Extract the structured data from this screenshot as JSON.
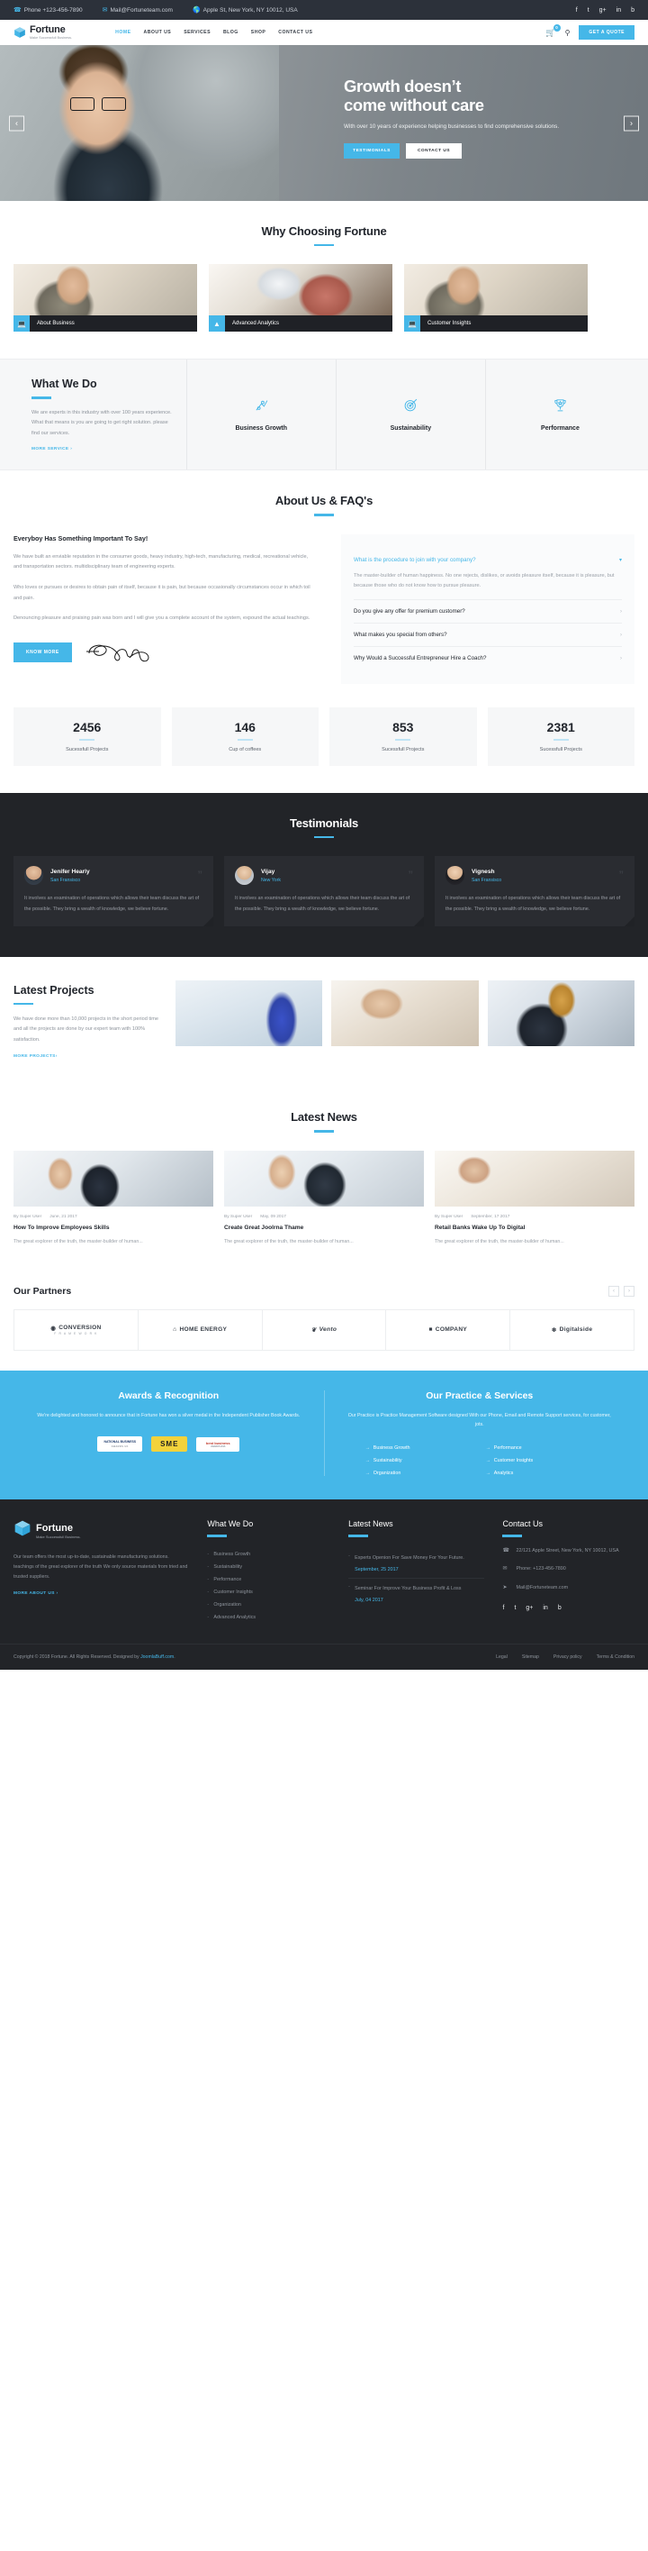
{
  "topbar": {
    "phone": "Phone +123-456-7890",
    "mail": "Mail@Fortuneteam.com",
    "address": "Apple St, New York, NY 10012, USA",
    "social": [
      "f",
      "t",
      "g+",
      "in",
      "b"
    ]
  },
  "brand": {
    "name": "Fortune",
    "tagline": "Make Successfull Business."
  },
  "nav": {
    "items": [
      "HOME",
      "ABOUT US",
      "SERVICES",
      "BLOG",
      "SHOP",
      "CONTACT US"
    ],
    "active": "HOME",
    "cart_count": "0",
    "quote_label": "GET A QUOTE"
  },
  "hero": {
    "title_line1": "Growth doesn’t",
    "title_line2": "come without care",
    "subtitle": "With over 10 years of experience helping businesses to find comprehensive solutions.",
    "btn_primary": "TESTIMONIALS",
    "btn_secondary": "CONTACT US",
    "arrow_left": "‹",
    "arrow_right": "›"
  },
  "why": {
    "title": "Why Choosing Fortune",
    "cards": [
      {
        "label": "About Business",
        "icon": "monitor-icon"
      },
      {
        "label": "Advanced Analytics",
        "icon": "chart-icon"
      },
      {
        "label": "Customer Insights",
        "icon": "monitor-icon"
      }
    ]
  },
  "what_we_do": {
    "title": "What We Do",
    "text": "We are experts in this industry with over 100 years experience. What that means is you are going to get right solution. please find our services.",
    "more": "MORE SERVICE ›",
    "services": [
      {
        "name": "Business Growth",
        "icon": "growth-icon"
      },
      {
        "name": "Sustainability",
        "icon": "target-icon"
      },
      {
        "name": "Performance",
        "icon": "trophy-icon"
      }
    ]
  },
  "about": {
    "title": "About Us & FAQ's",
    "heading": "Everyboy Has Something Important To Say!",
    "para1": "We have built an enviable reputation in the consumer goods, heavy industry, high-tech, manufacturing, medical, recreational vehicle, and transportation sectors. multidisciplinary team of engineering experts.",
    "para2": "Who loves or pursues or desires to obtain pain of itself, because it is pain, but because occasionally circumstances occur in which toil and pain.",
    "para3": "Denouncing pleasure and praising pain was born and I will give you a complete account of the system, expound the actual teachings.",
    "know_more": "KNOW MORE",
    "faqs": [
      {
        "q": "What is the procedure to join with your company?",
        "a": "The master-builder of human happiness. No one rejects, dislikes, or avoids pleasure itself, because it is pleasure, but because those who do not know how to pursue pleasure.",
        "open": true
      },
      {
        "q": "Do you give any offer for premium customer?",
        "a": "",
        "open": false
      },
      {
        "q": "What makes you special from others?",
        "a": "",
        "open": false
      },
      {
        "q": "Why Would a Successful Entrepreneur Hire a Coach?",
        "a": "",
        "open": false
      }
    ]
  },
  "counters": [
    {
      "num": "2456",
      "label": "Sucessfull Projects"
    },
    {
      "num": "146",
      "label": "Cup of coffees"
    },
    {
      "num": "853",
      "label": "Sucessfull Projects"
    },
    {
      "num": "2381",
      "label": "Sucessfull Projects"
    }
  ],
  "testimonials": {
    "title": "Testimonials",
    "items": [
      {
        "name": "Jenifer Hearly",
        "location": "San Fransisco",
        "text": "It involves an examination of operations which allows their team discuss the art of the possible. They bring a wealth of knowledge, we believe fortune."
      },
      {
        "name": "Vijay",
        "location": "New York",
        "text": "It involves an examination of operations which allows their team discuss the art of the possible. They bring a wealth of knowledge, we believe fortune."
      },
      {
        "name": "Vignesh",
        "location": "San Fransisco",
        "text": "It involves an examination of operations which allows their team discuss the art of the possible. They bring a wealth of knowledge, we believe fortune."
      }
    ]
  },
  "projects": {
    "title": "Latest Projects",
    "text": "We have done more than 10,000 projects in the short period time and all the projects are done by our expert team with 100% satisfaction.",
    "more": "MORE PROJECTS›"
  },
  "news": {
    "title": "Latest News",
    "items": [
      {
        "author": "By Super User",
        "date": "June, 21 2017",
        "title": "How To Improve Employees Skills",
        "excerpt": "The great explorer of the truth, the master-builder of human..."
      },
      {
        "author": "By Super User",
        "date": "May, 09 2017",
        "title": "Create Great Joolrna Thame",
        "excerpt": "The great explorer of the truth, the master-builder of human..."
      },
      {
        "author": "By Super User",
        "date": "September, 17 2017",
        "title": "Retail Banks Wake Up To Digital",
        "excerpt": "The great explorer of the truth, the master-builder of human..."
      }
    ]
  },
  "partners": {
    "title": "Our Partners",
    "prev": "‹",
    "next": "›",
    "items": [
      {
        "name": "CONVERSION",
        "sub": "F R A M E W O R K"
      },
      {
        "name": "HOME ENERGY",
        "sub": ""
      },
      {
        "name": "Vento",
        "sub": ""
      },
      {
        "name": "COMPANY",
        "sub": ""
      },
      {
        "name": "Digitalside",
        "sub": ""
      }
    ]
  },
  "awards": {
    "title": "Awards & Recognition",
    "text": "We're delighted and honored to announce that in Fortune has won a silver medal in the Independent Publisher Book Awards.",
    "badges": [
      {
        "title": "NATIONAL BUSINESS",
        "sub": "AWARDS UK"
      },
      {
        "title": "SME",
        "sub": ""
      },
      {
        "title": "best business",
        "sub": "AWARDS 2016"
      }
    ]
  },
  "practice": {
    "title": "Our Practice & Services",
    "text": "Our Practice is Practice Management Software designed With our Phone, Email and Remote Support services, for customer, jots.",
    "items": [
      "Business Growth",
      "Performance",
      "Sustainability",
      "Customer Insights",
      "Organization",
      "Analytics"
    ]
  },
  "footer": {
    "about_text": "Our team offers the most up-to-date, sustainable manufacturing solutions. teachings of the great explorer of the truth We only source materials from tried and trusted suppliers.",
    "more_about": "MORE ABOUT US ›",
    "wwd_title": "What We Do",
    "wwd_items": [
      "Business Growth",
      "Sustainability",
      "Performance",
      "Customer Insights",
      "Organization",
      "Advanced Analytics"
    ],
    "news_title": "Latest News",
    "news_items": [
      {
        "title": "Experts Openion For Save Money For Your Future.",
        "date": "September, 25 2017"
      },
      {
        "title": "Seminar For Improve Your Business Profit & Loss",
        "date": "July, 04 2017"
      }
    ],
    "contact_title": "Contact Us",
    "contact": [
      {
        "icon": "phone-icon",
        "text": "22/121 Apple Street, New York, NY 10012, USA"
      },
      {
        "icon": "mail-icon",
        "text": "Phone: +123-456-7890"
      },
      {
        "icon": "send-icon",
        "text": "Mail@Fortuneteam.com"
      }
    ],
    "social": [
      "f",
      "t",
      "g+",
      "in",
      "b"
    ],
    "copyright_pre": "Copyright © 2018 Fortune. All Rights Reserved. Designed by ",
    "copyright_link": "JoomlaBuff.com",
    "copyright_post": ".",
    "links": [
      "Legal",
      "Sitemap",
      "Privacy policy",
      "Terms & Condition"
    ]
  },
  "colors": {
    "accent": "#45b7e8",
    "dark": "#222428",
    "topbar": "#2c313a"
  }
}
